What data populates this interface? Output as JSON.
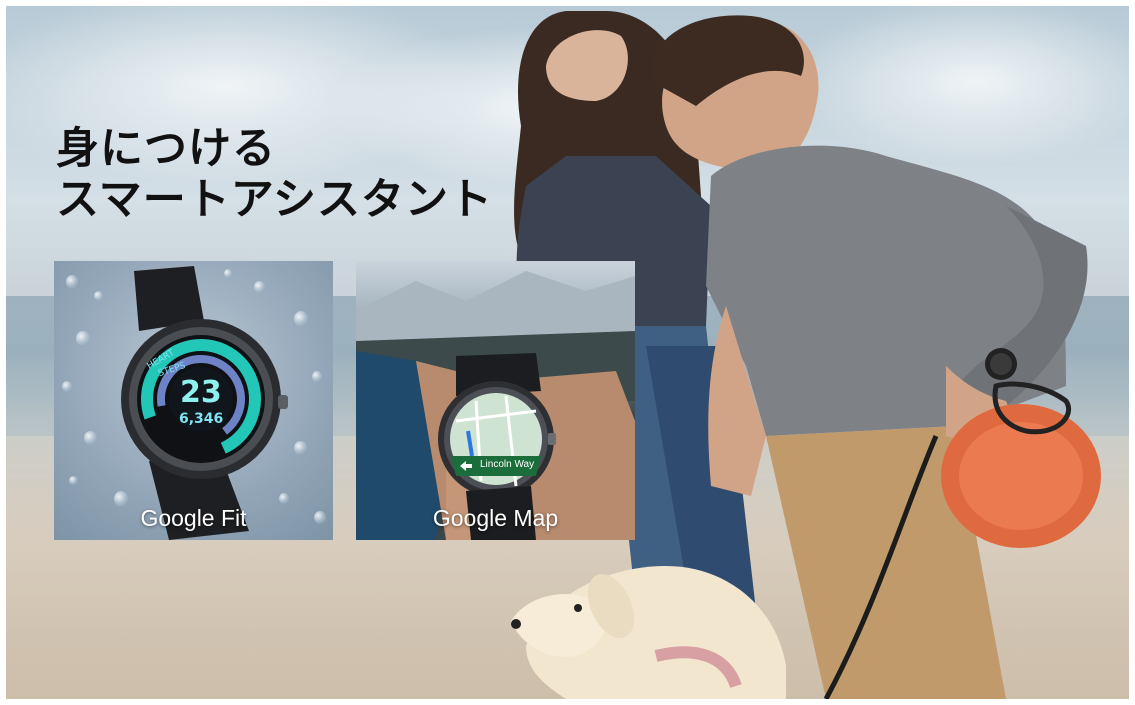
{
  "headline": {
    "line1": "身につける",
    "line2": "スマートアシスタント"
  },
  "cards": [
    {
      "label": "Google Fit",
      "watch": {
        "heart_label": "HEART",
        "steps_label": "STEPS",
        "heart_value": "23",
        "steps_value": "6,346"
      }
    },
    {
      "label": "Google Map",
      "watch": {
        "street": "Lincoln Way"
      }
    }
  ],
  "colors": {
    "accent_teal": "#23c7b8",
    "headline": "#111111",
    "card_label": "#ffffff"
  },
  "icons": [
    "turn-left-arrow-icon",
    "watch-crown-icon"
  ]
}
